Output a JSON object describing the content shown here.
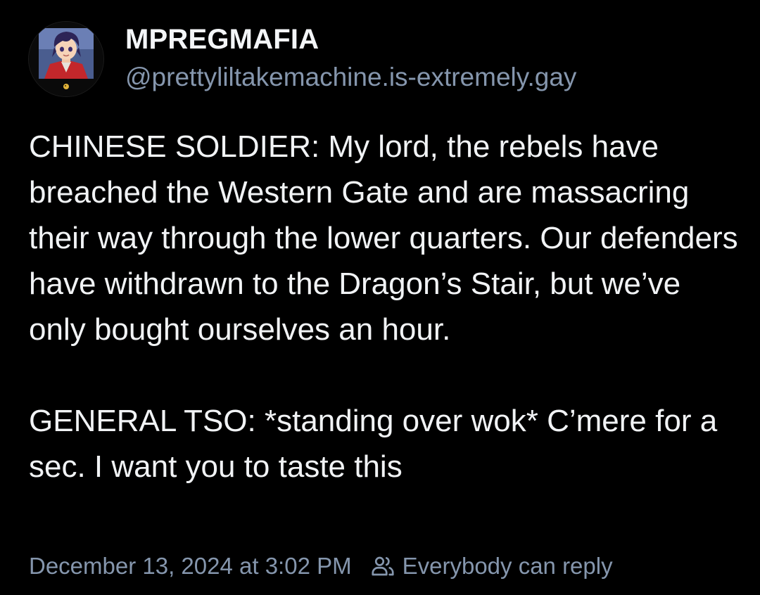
{
  "author": {
    "display_name": "MPREGMAFIA",
    "handle": "@prettyliltakemachine.is-extremely.gay",
    "avatar_icon": "anime-character-avatar-icon"
  },
  "post": {
    "paragraphs": [
      "CHINESE SOLDIER: My lord, the rebels have breached the Western Gate and are massacring their way through the lower quarters. Our defenders have withdrawn to the Dragon’s Stair, but we’ve only bought ourselves an hour.",
      "GENERAL TSO: *standing over wok* C’mere for a sec. I want you to taste this"
    ]
  },
  "footer": {
    "timestamp": "December 13, 2024 at 3:02 PM",
    "reply_icon": "people-icon",
    "reply_setting": "Everybody can reply"
  },
  "colors": {
    "background": "#000000",
    "text": "#f1f3f5",
    "muted": "#8596ad"
  }
}
